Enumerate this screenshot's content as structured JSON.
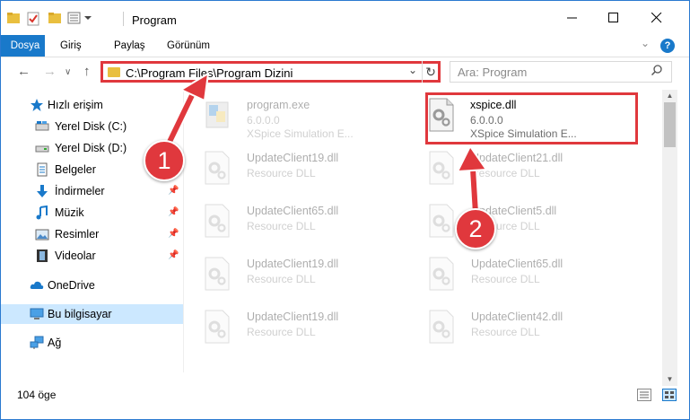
{
  "window": {
    "title": "Program"
  },
  "ribbon": {
    "tabs": [
      "Dosya",
      "Giriş",
      "Paylaş",
      "Görünüm"
    ]
  },
  "nav": {
    "address": "C:\\Program Files\\Program Dizini",
    "search_placeholder": "Ara: Program"
  },
  "sidebar": {
    "items": [
      {
        "label": "Hızlı erişim",
        "icon": "star-icon"
      },
      {
        "label": "Yerel Disk (C:)",
        "icon": "drive-icon"
      },
      {
        "label": "Yerel Disk (D:)",
        "icon": "drive-icon"
      },
      {
        "label": "Belgeler",
        "icon": "documents-icon"
      },
      {
        "label": "İndirmeler",
        "icon": "download-icon"
      },
      {
        "label": "Müzik",
        "icon": "music-icon"
      },
      {
        "label": "Resimler",
        "icon": "pictures-icon"
      },
      {
        "label": "Videolar",
        "icon": "video-icon"
      },
      {
        "label": "OneDrive",
        "icon": "cloud-icon"
      },
      {
        "label": "Bu bilgisayar",
        "icon": "computer-icon"
      },
      {
        "label": "Ağ",
        "icon": "network-icon"
      }
    ]
  },
  "files": [
    {
      "name": "program.exe",
      "line2": "6.0.0.0",
      "line3": "XSpice Simulation E..."
    },
    {
      "name": "xspice.dll",
      "line2": "6.0.0.0",
      "line3": "XSpice Simulation E..."
    },
    {
      "name": "UpdateClient19.dll",
      "line2": "Resource DLL",
      "line3": ""
    },
    {
      "name": "UpdateClient21.dll",
      "line2": "Resource DLL",
      "line3": ""
    },
    {
      "name": "UpdateClient65.dll",
      "line2": "Resource DLL",
      "line3": ""
    },
    {
      "name": "UpdateClient5.dll",
      "line2": "Resource DLL",
      "line3": ""
    },
    {
      "name": "UpdateClient19.dll",
      "line2": "Resource DLL",
      "line3": ""
    },
    {
      "name": "UpdateClient65.dll",
      "line2": "Resource DLL",
      "line3": ""
    },
    {
      "name": "UpdateClient19.dll",
      "line2": "Resource DLL",
      "line3": ""
    },
    {
      "name": "UpdateClient42.dll",
      "line2": "Resource DLL",
      "line3": ""
    }
  ],
  "status": {
    "count": "104 öge"
  },
  "callouts": [
    "1",
    "2"
  ],
  "colors": {
    "accent": "#1979ca",
    "highlight": "#e0383d",
    "selection": "#cce8ff"
  }
}
